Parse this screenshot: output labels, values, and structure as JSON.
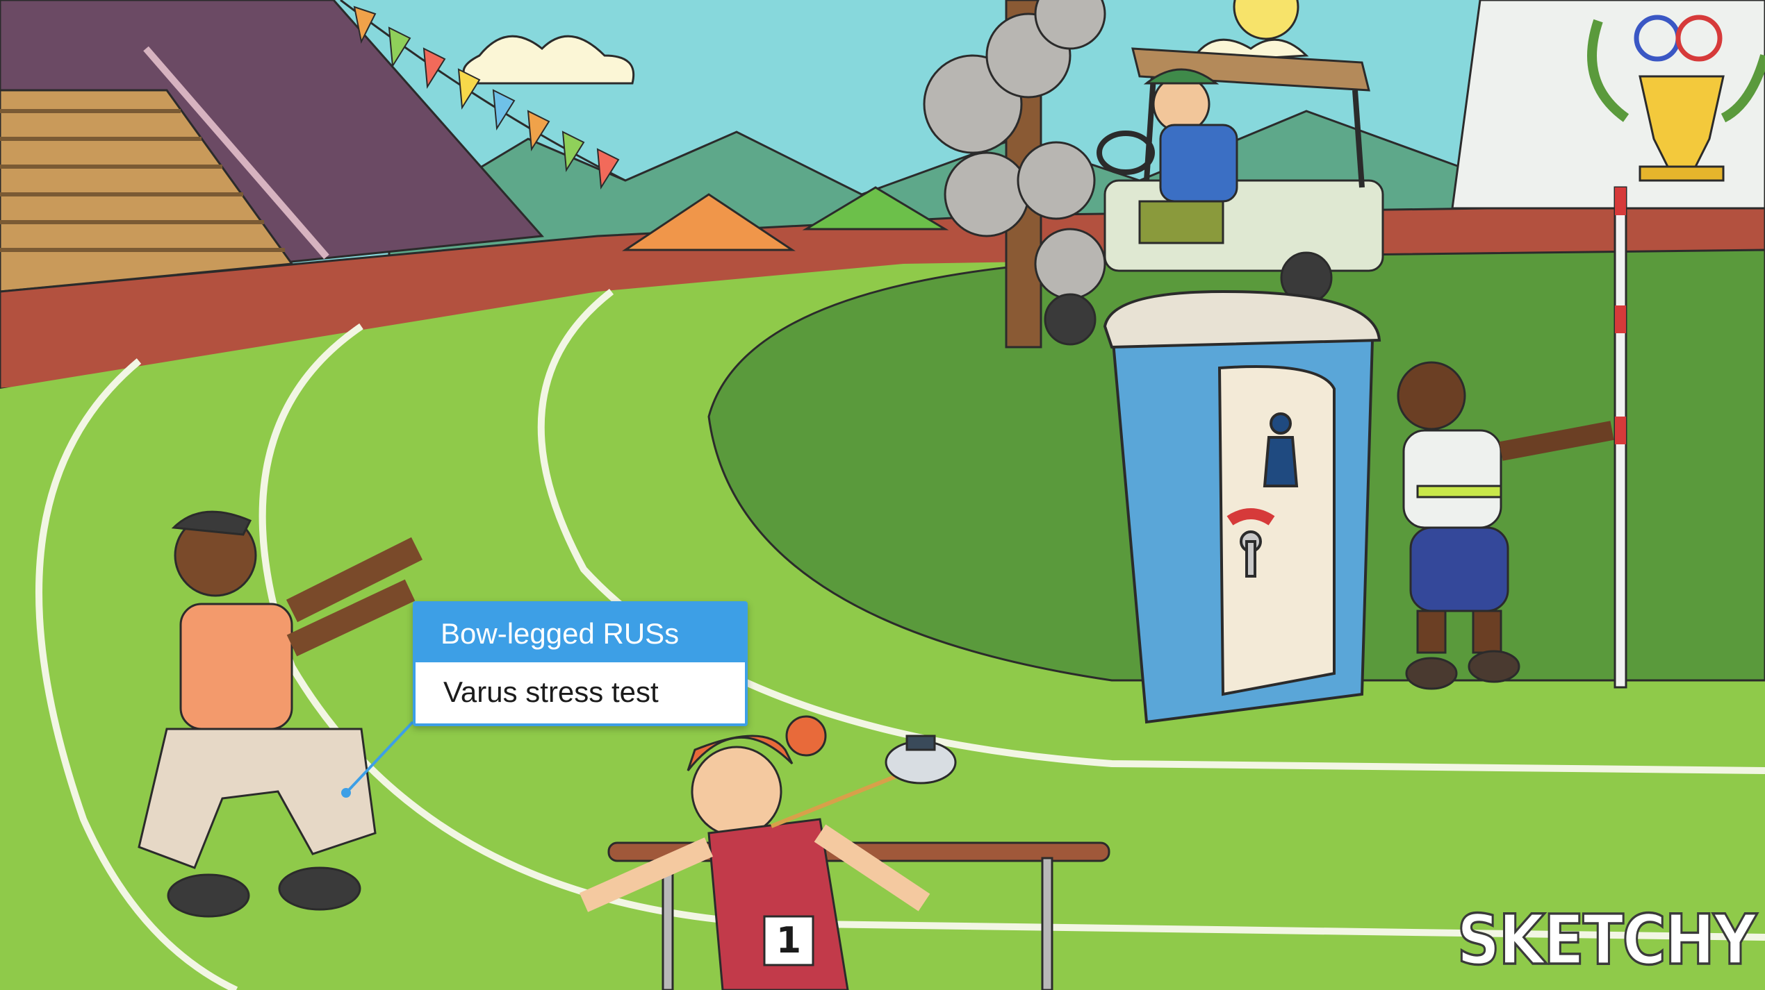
{
  "scene": {
    "colors": {
      "sky": "#87d8dc",
      "grass": "#8fca4a",
      "infield": "#5a9a3c",
      "track_lines": "#f2f6e4",
      "tooltip_accent": "#3d9fe6",
      "portapotty": "#5aa6d8"
    },
    "icons": [
      "sun-icon",
      "olympic-rings-icon",
      "trophy-icon",
      "restroom-person-icon",
      "occupied-lock-icon"
    ]
  },
  "tooltip": {
    "header": "Bow-legged RUSs",
    "body": "Varus stress test"
  },
  "bib_number": "1",
  "portapotty_sign": "OCCUPIED",
  "watermark": "SKETCHY"
}
